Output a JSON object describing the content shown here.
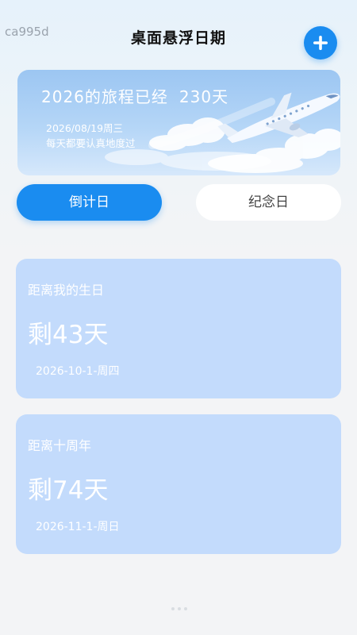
{
  "watermark": "ca995d",
  "header": {
    "title": "桌面悬浮日期",
    "add_icon": "plus-icon"
  },
  "banner": {
    "title": "2026的旅程已经",
    "days": "230天",
    "date": "2026/08/19周三",
    "motto": "每天都要认真地度过",
    "art_icon": "airplane-icon"
  },
  "tabs": [
    {
      "label": "倒计日",
      "active": true
    },
    {
      "label": "纪念日",
      "active": false
    }
  ],
  "events": [
    {
      "name": "距离我的生日",
      "remaining": "剩43天",
      "date": "2026-10-1-周四"
    },
    {
      "name": "距离十周年",
      "remaining": "剩74天",
      "date": "2026-11-1-周日"
    }
  ],
  "colors": {
    "accent": "#1a8cf0",
    "card": "#c3dbfc"
  }
}
